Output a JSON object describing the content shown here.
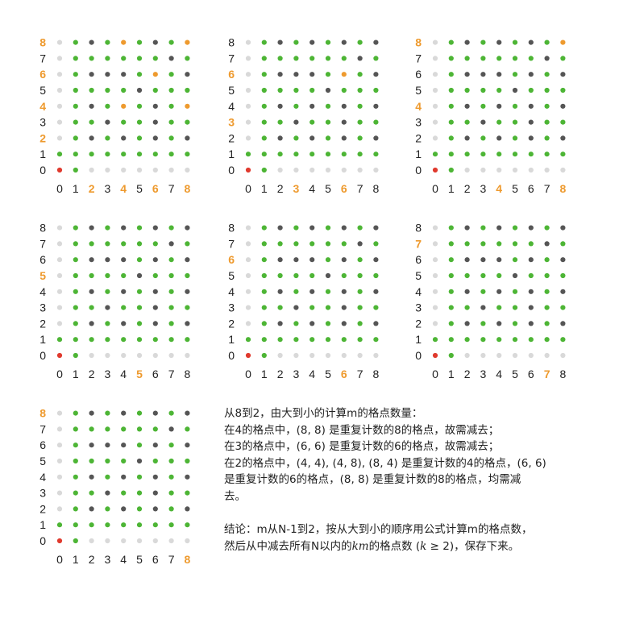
{
  "colors": {
    "red": "#e03a2e",
    "green": "#4db535",
    "dark": "#555555",
    "light": "#d9d9d9",
    "orange": "#ee9a2e",
    "label": "#222222"
  },
  "grid": {
    "x_ticks": [
      "0",
      "1",
      "2",
      "3",
      "4",
      "5",
      "6",
      "7",
      "8"
    ],
    "y_ticks": [
      "0",
      "1",
      "2",
      "3",
      "4",
      "5",
      "6",
      "7",
      "8"
    ]
  },
  "panels": [
    {
      "m": 2,
      "hl_x": [
        2,
        4,
        6,
        8
      ],
      "hl_y": [
        2,
        4,
        6,
        8
      ],
      "orange": [
        [
          4,
          8
        ],
        [
          8,
          8
        ],
        [
          6,
          6
        ],
        [
          4,
          4
        ],
        [
          8,
          4
        ]
      ]
    },
    {
      "m": 3,
      "hl_x": [
        3,
        6
      ],
      "hl_y": [
        3,
        6
      ],
      "orange": [
        [
          6,
          6
        ]
      ]
    },
    {
      "m": 4,
      "hl_x": [
        4,
        8
      ],
      "hl_y": [
        4,
        8
      ],
      "orange": [
        [
          8,
          8
        ]
      ]
    },
    {
      "m": 5,
      "hl_x": [
        5
      ],
      "hl_y": [
        5
      ],
      "orange": []
    },
    {
      "m": 6,
      "hl_x": [
        6
      ],
      "hl_y": [
        6
      ],
      "orange": []
    },
    {
      "m": 7,
      "hl_x": [
        7
      ],
      "hl_y": [
        7
      ],
      "orange": []
    },
    {
      "m": 8,
      "hl_x": [
        8
      ],
      "hl_y": [
        8
      ],
      "orange": []
    }
  ],
  "text": {
    "line1": "从8到2，由大到小的计算m的格点数量：",
    "line2": "在4的格点中，(8, 8) 是重复计数的8的格点，故需减去；",
    "line3": "在3的格点中，(6, 6) 是重复计数的6的格点，故需减去；",
    "line4": "在2的格点中，(4, 4), (4, 8), (8, 4) 是重复计数的4的格点，(6, 6)",
    "line5": "是重复计数的6的格点，(8,   8)  是重复计数的8的格点，均需减",
    "line6": "去。",
    "concl_a": "结论：m从N-1到2，按从大到小的顺序用公式计算m的格点数，",
    "concl_b1": "然后从中减去所有N以内的",
    "concl_km": "km",
    "concl_b2": "的格点数 (",
    "concl_k": "k",
    "concl_b3": " ≥ 2)，保存下来。"
  }
}
